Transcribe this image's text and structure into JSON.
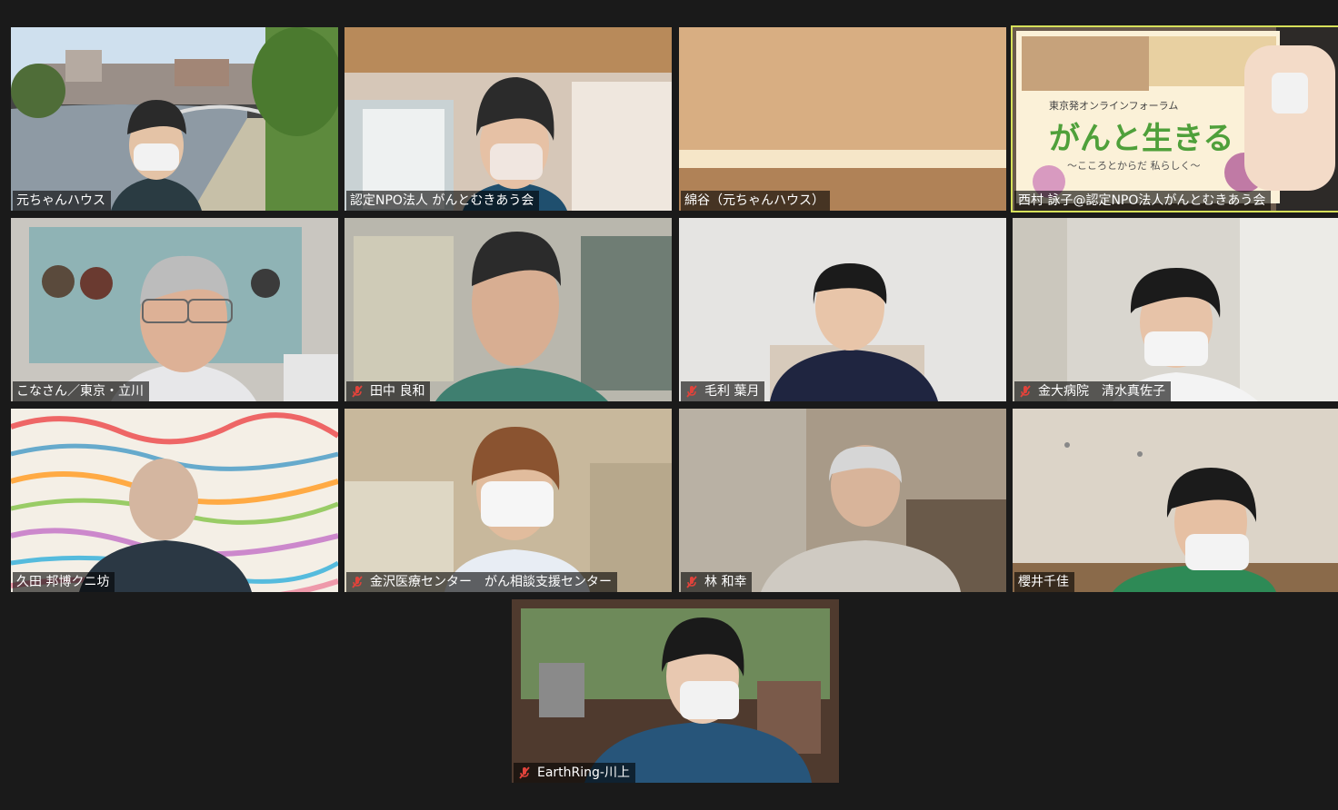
{
  "participants": [
    {
      "name": "元ちゃんハウス",
      "muted": false
    },
    {
      "name": "認定NPO法人 がんとむきあう会",
      "muted": false
    },
    {
      "name": "綿谷（元ちゃんハウス）",
      "muted": false
    },
    {
      "name": "西村 詠子@認定NPO法人がんとむきあう会",
      "muted": false
    },
    {
      "name": "こなさん／東京・立川",
      "muted": false
    },
    {
      "name": "田中 良和",
      "muted": true
    },
    {
      "name": "毛利 葉月",
      "muted": true
    },
    {
      "name": "金大病院　清水真佐子",
      "muted": true
    },
    {
      "name": "久田 邦博クニ坊",
      "muted": false
    },
    {
      "name": "金沢医療センター　がん相談支援センター",
      "muted": true
    },
    {
      "name": "林 和幸",
      "muted": true
    },
    {
      "name": "櫻井千佳",
      "muted": false
    },
    {
      "name": "EarthRing-川上",
      "muted": true
    }
  ],
  "shared_poster": {
    "subtitle": "東京発オンラインフォーラム",
    "title": "がんと生きる",
    "tagline": "～こころとからだ 私らしく～"
  },
  "colors": {
    "active_speaker": "#d6e05a",
    "muted": "#e0433b"
  }
}
